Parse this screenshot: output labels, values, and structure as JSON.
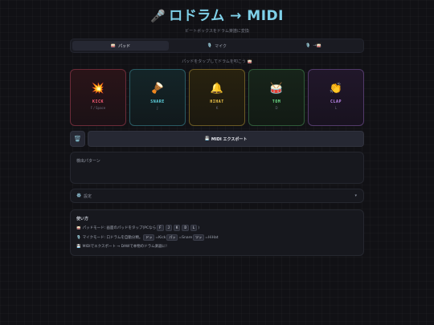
{
  "header": {
    "title_icon": "🎤",
    "title": "ロドラム → MIDI",
    "subtitle": "ビートボックスをドラム楽譜に変換"
  },
  "tabs": [
    {
      "icon": "🥁",
      "label": "パッド",
      "active": true
    },
    {
      "icon": "🎙️",
      "label": "マイク",
      "active": false
    },
    {
      "icon": "🎙️",
      "label": "→🥁",
      "active": false
    }
  ],
  "hint": "パッドをタップしてドラムを叩こう 🥁",
  "pads": [
    {
      "emoji": "💥",
      "name": "KICK",
      "key": "F / Space"
    },
    {
      "emoji": "🪘",
      "name": "SNARE",
      "key": "J"
    },
    {
      "emoji": "🔔",
      "name": "HIHAT",
      "key": "K"
    },
    {
      "emoji": "🥁",
      "name": "TOM",
      "key": "D"
    },
    {
      "emoji": "👏",
      "name": "CLAP",
      "key": "L"
    }
  ],
  "actions": {
    "trash_icon": "🗑️",
    "export_icon": "💾",
    "export_label": "MIDI エクスポート"
  },
  "pattern": {
    "label": "検出パターン"
  },
  "settings": {
    "icon": "⚙️",
    "label": "設定",
    "chevron": "▾"
  },
  "howto": {
    "title": "使い方",
    "line1_icon": "🥁",
    "line1_text": "パッドモード: 画面のパッドをタップ(PCなら",
    "line1_keys": [
      "F",
      "J",
      "K",
      "D",
      "L"
    ],
    "line1_end": ")",
    "line2_icon": "🎙️",
    "line2_text": "マイクモード: 口ドラムを自動分類。",
    "line2_k1": "ドッ",
    "line2_t1": "=Kick",
    "line2_k2": "パッ",
    "line2_t2": "=Snare",
    "line2_k3": "ツッ",
    "line2_t3": "=HiHat",
    "line3_icon": "💾",
    "line3_text": "MIDIでエクスポート → DAWで本物のドラム楽器に!"
  }
}
